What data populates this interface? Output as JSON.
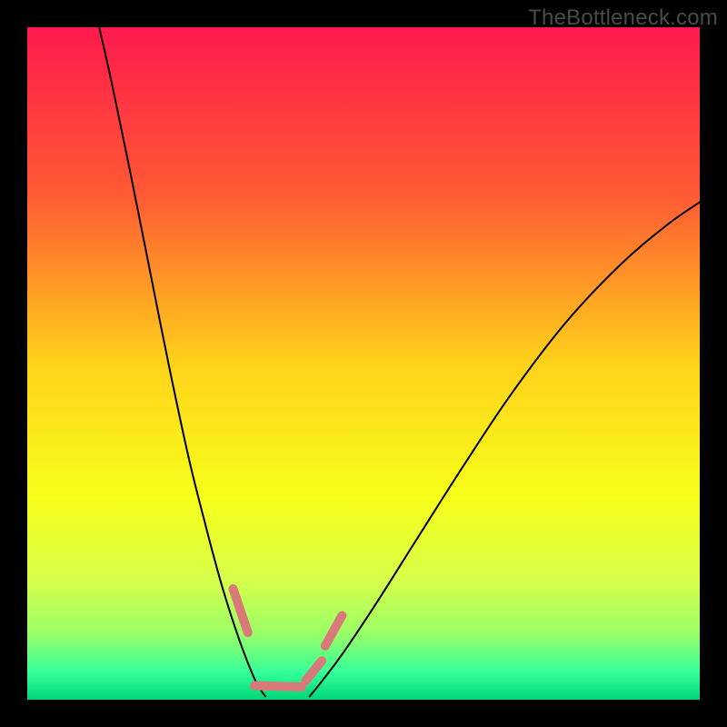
{
  "watermark": "TheBottleneck.com",
  "chart_data": {
    "type": "line",
    "title": "",
    "xlabel": "",
    "ylabel": "",
    "xlim": [
      0,
      100
    ],
    "ylim": [
      0,
      100
    ],
    "grid": false,
    "legend": false,
    "background_gradient_stops": [
      {
        "offset": 0.0,
        "color": "#ff1a4d"
      },
      {
        "offset": 0.25,
        "color": "#ff5a33"
      },
      {
        "offset": 0.5,
        "color": "#ffd21a"
      },
      {
        "offset": 0.7,
        "color": "#f7ff1a"
      },
      {
        "offset": 0.82,
        "color": "#d8ff4a"
      },
      {
        "offset": 0.9,
        "color": "#9bff66"
      },
      {
        "offset": 0.96,
        "color": "#33ff99"
      },
      {
        "offset": 1.0,
        "color": "#00d67a"
      }
    ],
    "series": [
      {
        "name": "left-arm",
        "color": "#000000",
        "stroke_width": 2,
        "points": [
          {
            "x": 10.7,
            "y": 100.0
          },
          {
            "x": 12.5,
            "y": 92.0
          },
          {
            "x": 15.0,
            "y": 80.0
          },
          {
            "x": 18.0,
            "y": 65.0
          },
          {
            "x": 21.0,
            "y": 50.0
          },
          {
            "x": 24.0,
            "y": 36.0
          },
          {
            "x": 26.5,
            "y": 26.0
          },
          {
            "x": 28.5,
            "y": 18.5
          },
          {
            "x": 30.0,
            "y": 13.5
          },
          {
            "x": 31.5,
            "y": 9.0
          },
          {
            "x": 33.0,
            "y": 5.0
          },
          {
            "x": 34.2,
            "y": 2.3
          },
          {
            "x": 35.4,
            "y": 0.5
          }
        ]
      },
      {
        "name": "right-arm",
        "color": "#000000",
        "stroke_width": 2,
        "points": [
          {
            "x": 42.0,
            "y": 0.5
          },
          {
            "x": 44.0,
            "y": 3.0
          },
          {
            "x": 47.0,
            "y": 7.0
          },
          {
            "x": 52.0,
            "y": 14.5
          },
          {
            "x": 58.0,
            "y": 24.0
          },
          {
            "x": 65.0,
            "y": 35.0
          },
          {
            "x": 72.0,
            "y": 45.5
          },
          {
            "x": 80.0,
            "y": 56.0
          },
          {
            "x": 88.0,
            "y": 64.5
          },
          {
            "x": 95.0,
            "y": 70.5
          },
          {
            "x": 100.0,
            "y": 74.0
          }
        ]
      }
    ],
    "overlay_marks": {
      "color": "#d97a7a",
      "stroke_width": 10,
      "segments": [
        {
          "x1": 30.6,
          "y1": 16.5,
          "x2": 32.8,
          "y2": 10.0
        },
        {
          "x1": 33.8,
          "y1": 2.1,
          "x2": 40.8,
          "y2": 1.9
        },
        {
          "x1": 41.4,
          "y1": 2.8,
          "x2": 43.8,
          "y2": 5.8
        },
        {
          "x1": 44.3,
          "y1": 8.0,
          "x2": 46.8,
          "y2": 12.5
        }
      ]
    }
  }
}
